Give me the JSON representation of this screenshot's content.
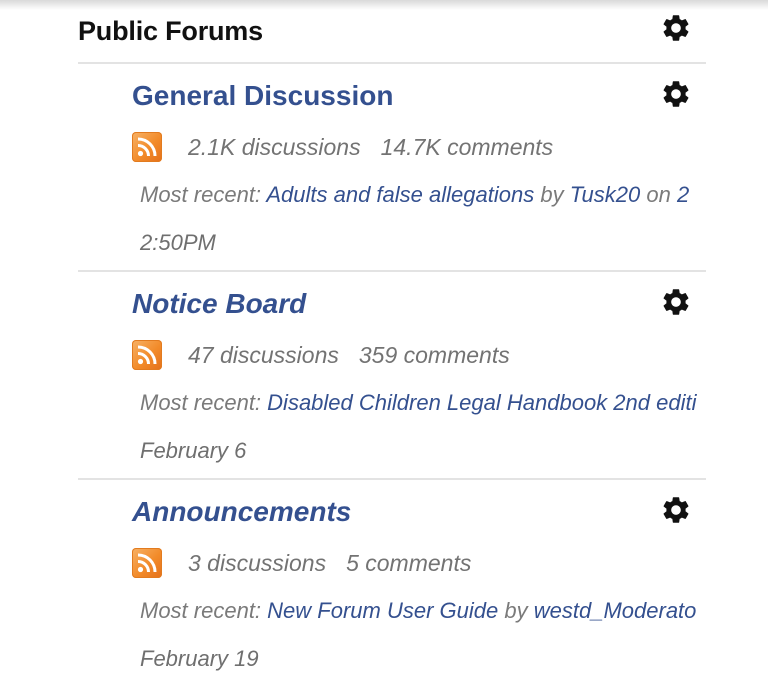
{
  "header": {
    "title": "Public Forums",
    "settings_icon": "gear-icon"
  },
  "forums": [
    {
      "title": "General Discussion",
      "title_italic": false,
      "discussions": "2.1K discussions",
      "comments": "14.7K comments",
      "recent_prefix": "Most recent:",
      "recent_link": "Adults and false allegations",
      "by_text": "by",
      "author": "Tusk20",
      "on_text": "on",
      "on_value": "2",
      "date": "2:50PM"
    },
    {
      "title": "Notice Board",
      "title_italic": true,
      "discussions": "47 discussions",
      "comments": "359 comments",
      "recent_prefix": "Most recent:",
      "recent_link": "Disabled Children Legal Handbook 2nd editi",
      "date": "February 6"
    },
    {
      "title": "Announcements",
      "title_italic": true,
      "discussions": "3 discussions",
      "comments": "5 comments",
      "recent_prefix": "Most recent:",
      "recent_link": "New Forum User Guide",
      "by_text": "by",
      "author": "westd_Moderato",
      "date": "February 19"
    }
  ],
  "colors": {
    "link": "#34508f",
    "meta_text": "#737373",
    "rss_orange": "#f28b2a"
  },
  "icons": {
    "settings": "gear-icon",
    "feed": "rss-feed-icon"
  }
}
